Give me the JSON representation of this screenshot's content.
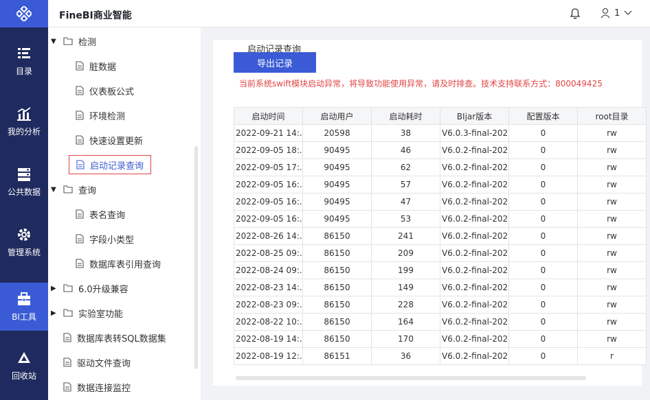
{
  "header": {
    "app_title": "FineBI商业智能",
    "user_name": "1"
  },
  "leftnav": [
    {
      "label": "目录",
      "icon": "catalog-icon"
    },
    {
      "label": "我的分析",
      "icon": "analysis-icon"
    },
    {
      "label": "公共数据",
      "icon": "public-data-icon"
    },
    {
      "label": "管理系统",
      "icon": "gear-icon"
    },
    {
      "label": "BI工具",
      "icon": "toolbox-icon",
      "active": true
    },
    {
      "label": "回收站",
      "icon": "recycle-icon"
    }
  ],
  "tree": {
    "detect": "检测",
    "dirty": "脏数据",
    "dashboard_formula": "仪表板公式",
    "env_check": "环境检测",
    "quick_update": "快速设置更新",
    "startup_query": "启动记录查询",
    "query": "查询",
    "table_query": "表名查询",
    "field_type": "字段小类型",
    "db_ref": "数据库表引用查询",
    "upgrade": "6.0升级兼容",
    "lab": "实验室功能",
    "db_sql": "数据库表转SQL数据集",
    "driver_query": "驱动文件查询",
    "conn_monitor": "数据连接监控"
  },
  "content": {
    "sub_title": "启动记录查询",
    "export_label": "导出记录",
    "warning": "当前系统swift模块启动异常，将导致功能使用异常，请及时排查。技术支持联系方式：800049425",
    "columns": [
      "启动时间",
      "启动用户",
      "启动耗时",
      "BIjar版本",
      "配置版本",
      "root目录"
    ],
    "rows": [
      [
        "2022-09-21 14:...",
        "20598",
        "38",
        "V6.0.3-final-202...",
        "0",
        "rw"
      ],
      [
        "2022-09-05 18:...",
        "90495",
        "46",
        "V6.0.2-final-202...",
        "0",
        "rw"
      ],
      [
        "2022-09-05 17:...",
        "90495",
        "62",
        "V6.0.2-final-202...",
        "0",
        "rw"
      ],
      [
        "2022-09-05 16:...",
        "90495",
        "57",
        "V6.0.2-final-202...",
        "0",
        "rw"
      ],
      [
        "2022-09-05 16:...",
        "90495",
        "47",
        "V6.0.2-final-202...",
        "0",
        "rw"
      ],
      [
        "2022-09-05 16:...",
        "90495",
        "53",
        "V6.0.2-final-202...",
        "0",
        "rw"
      ],
      [
        "2022-08-26 14:...",
        "86150",
        "241",
        "V6.0.2-final-202...",
        "0",
        "rw"
      ],
      [
        "2022-08-25 09:...",
        "86150",
        "209",
        "V6.0.2-final-202...",
        "0",
        "rw"
      ],
      [
        "2022-08-24 09:...",
        "86150",
        "199",
        "V6.0.2-final-202...",
        "0",
        "rw"
      ],
      [
        "2022-08-23 14:...",
        "86150",
        "149",
        "V6.0.2-final-202...",
        "0",
        "rw"
      ],
      [
        "2022-08-23 09:...",
        "86150",
        "228",
        "V6.0.2-final-202...",
        "0",
        "rw"
      ],
      [
        "2022-08-22 10:...",
        "86150",
        "164",
        "V6.0.2-final-202...",
        "0",
        "rw"
      ],
      [
        "2022-08-19 14:...",
        "86150",
        "170",
        "V6.0.2-final-202...",
        "0",
        "rw"
      ],
      [
        "2022-08-19 12:...",
        "86151",
        "36",
        "V6.0.2-final-202...",
        "0",
        "r"
      ]
    ]
  }
}
